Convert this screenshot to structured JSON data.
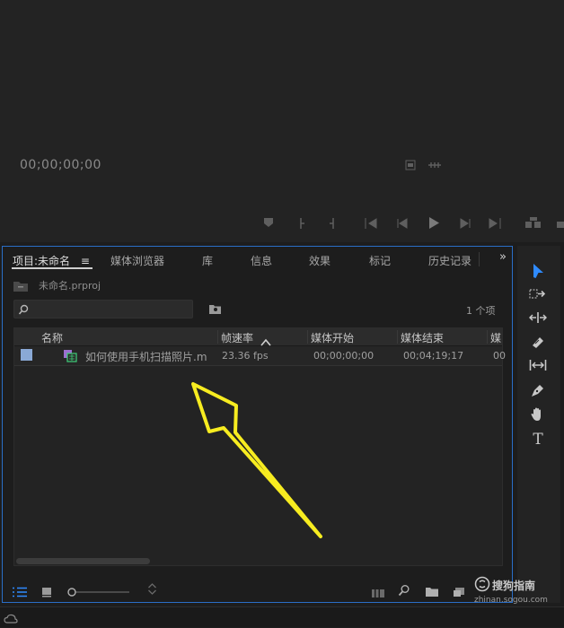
{
  "monitor": {
    "timecode": "00;00;00;00"
  },
  "panel": {
    "tabs": [
      {
        "label": "项目:未命名",
        "menu": "≡"
      },
      {
        "label": "媒体浏览器"
      },
      {
        "label": "库"
      },
      {
        "label": "信息"
      },
      {
        "label": "效果"
      },
      {
        "label": "标记"
      },
      {
        "label": "历史记录"
      }
    ],
    "overflow": "»",
    "bin_path": "未命名.prproj",
    "search_value": "",
    "item_count": "1 个项",
    "columns": [
      "名称",
      "帧速率",
      "媒体开始",
      "媒体结束",
      "媒"
    ],
    "rows": [
      {
        "name": "如何使用手机扫描照片.m",
        "fps": "23.36 fps",
        "start": "00;00;00;00",
        "end": "00;04;19;17",
        "extra": "00"
      }
    ]
  },
  "tools": [
    "selection-tool",
    "track-select-tool",
    "ripple-edit-tool",
    "razor-tool",
    "slip-tool",
    "pen-tool",
    "hand-tool",
    "type-tool"
  ],
  "tool_type_glyph": "T",
  "watermark": {
    "main": "搜狗指南",
    "sub": "zhinan.sogou.com"
  },
  "colors": {
    "accent": "#2f8bff",
    "panel_border": "#2a6ec7",
    "annotation_arrow": "#f7ec20",
    "label_color": "#8aa9d6"
  }
}
